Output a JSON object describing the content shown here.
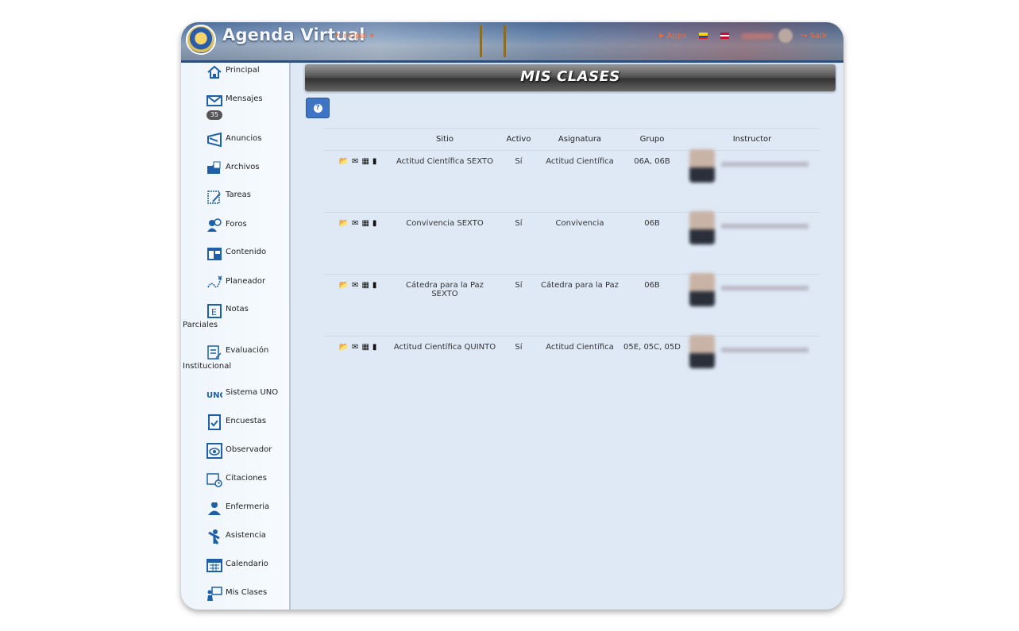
{
  "header": {
    "brand": "Agenda Virtual",
    "menu_label": "Principal ▾",
    "apps_label": "Apps",
    "logout_label": "Salir"
  },
  "sidebar": {
    "items": [
      {
        "label": "Principal",
        "icon": "home-icon"
      },
      {
        "label": "Mensajes",
        "icon": "envelope-icon",
        "badge": "35"
      },
      {
        "label": "Anuncios",
        "icon": "megaphone-icon"
      },
      {
        "label": "Archivos",
        "icon": "folder-icon"
      },
      {
        "label": "Tareas",
        "icon": "tasks-icon"
      },
      {
        "label": "Foros",
        "icon": "forum-icon"
      },
      {
        "label": "Contenido",
        "icon": "content-icon"
      },
      {
        "label": "Planeador",
        "icon": "planner-icon"
      },
      {
        "label": "Notas Parciales",
        "icon": "grades-icon"
      },
      {
        "label": "Evaluación Institucional",
        "icon": "evaluation-icon"
      },
      {
        "label": "Sistema UNO",
        "icon": "uno-icon"
      },
      {
        "label": "Encuestas",
        "icon": "survey-icon"
      },
      {
        "label": "Observador",
        "icon": "observer-icon"
      },
      {
        "label": "Citaciones",
        "icon": "calendar-clock-icon"
      },
      {
        "label": "Enfermeria",
        "icon": "nurse-icon"
      },
      {
        "label": "Asistencia",
        "icon": "attendance-icon"
      },
      {
        "label": "Calendario",
        "icon": "calendar-icon"
      },
      {
        "label": "Mis Clases",
        "icon": "classroom-icon"
      }
    ]
  },
  "main": {
    "title": "MIS CLASES",
    "help_glyph": "?",
    "columns": [
      "Sitio",
      "Activo",
      "Asignatura",
      "Grupo",
      "Instructor"
    ],
    "rows": [
      {
        "sitio": "Actitud Científica SEXTO",
        "activo": "Sí",
        "asignatura": "Actitud Científica",
        "grupo": "06A, 06B"
      },
      {
        "sitio": "Convivencia SEXTO",
        "activo": "Sí",
        "asignatura": "Convivencia",
        "grupo": "06B"
      },
      {
        "sitio": "Cátedra para la Paz SEXTO",
        "activo": "Sí",
        "asignatura": "Cátedra para la Paz",
        "grupo": "06B"
      },
      {
        "sitio": "Actitud Científica QUINTO",
        "activo": "Sí",
        "asignatura": "Actitud Científica",
        "grupo": "05E, 05C, 05D"
      }
    ]
  }
}
